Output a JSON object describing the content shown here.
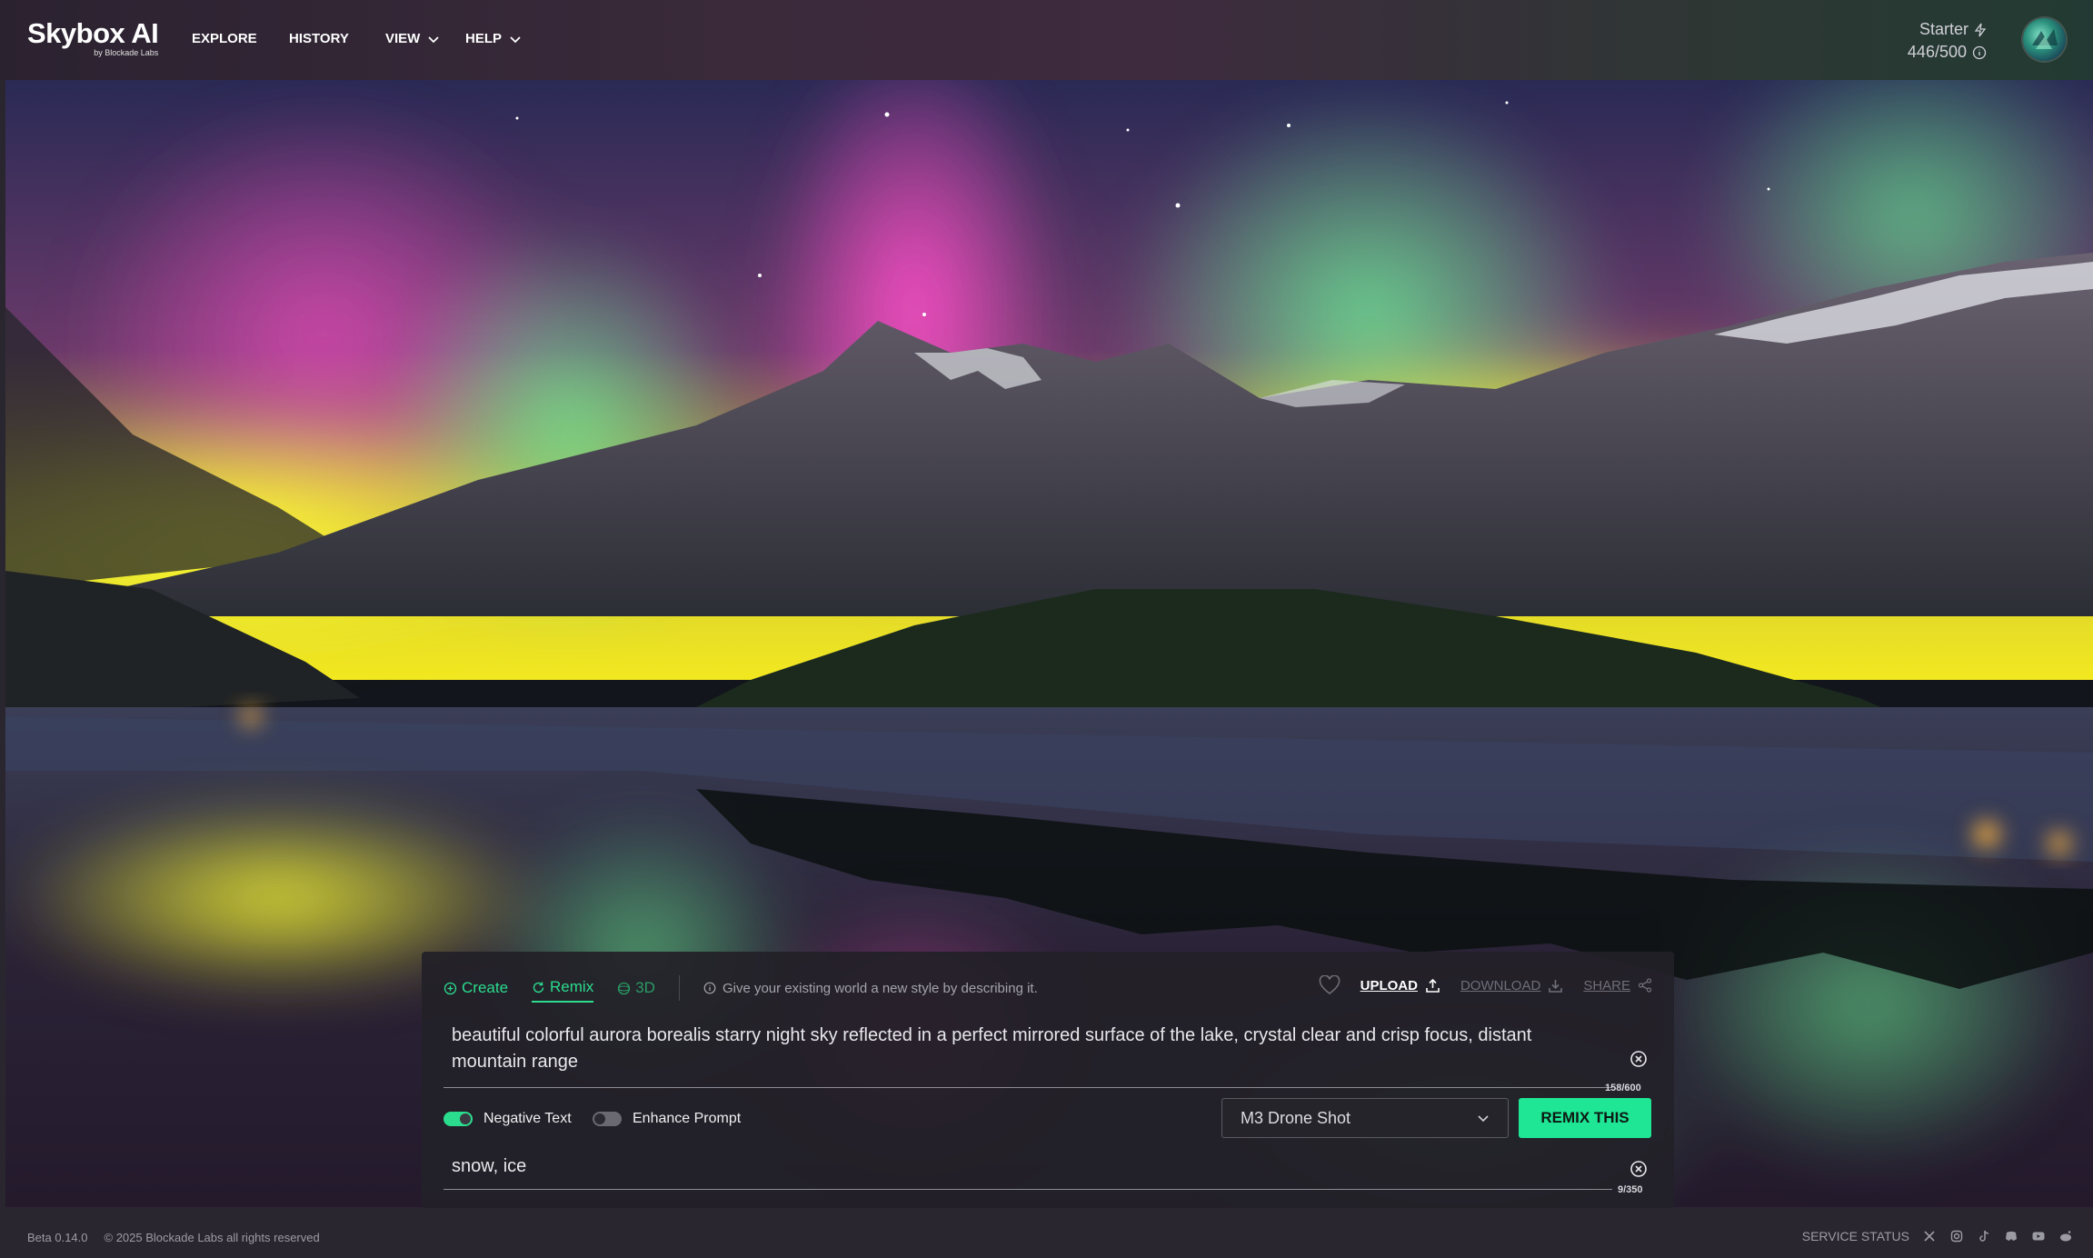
{
  "header": {
    "logo": "Skybox AI",
    "logo_sub": "by Blockade Labs",
    "nav": [
      {
        "label": "EXPLORE"
      },
      {
        "label": "HISTORY"
      },
      {
        "label": "VIEW"
      },
      {
        "label": "HELP"
      }
    ],
    "plan_name": "Starter",
    "credits": "446/500"
  },
  "panel": {
    "tabs": [
      {
        "label": "Create"
      },
      {
        "label": "Remix"
      },
      {
        "label": "3D"
      }
    ],
    "hint": "Give your existing world a new style by describing it.",
    "actions": {
      "upload": "UPLOAD",
      "download": "DOWNLOAD",
      "share": "SHARE"
    },
    "prompt": "beautiful colorful aurora borealis starry night sky reflected in a perfect mirrored surface of the lake, crystal clear and crisp focus, distant mountain range",
    "prompt_counter": "158/600",
    "negative_toggle_label": "Negative Text",
    "enhance_toggle_label": "Enhance Prompt",
    "style_selected": "M3 Drone Shot",
    "remix_button": "REMIX THIS",
    "negative_text": "snow, ice",
    "negative_counter": "9/350"
  },
  "footer": {
    "version": "Beta 0.14.0",
    "copyright": "© 2025 Blockade Labs all rights reserved",
    "service_status": "SERVICE STATUS",
    "social_icons": [
      "x-icon",
      "instagram-icon",
      "tiktok-icon",
      "discord-icon",
      "youtube-icon",
      "reddit-icon"
    ]
  },
  "colors": {
    "accent": "#1fe695",
    "tab_green": "#2bdc8e"
  }
}
